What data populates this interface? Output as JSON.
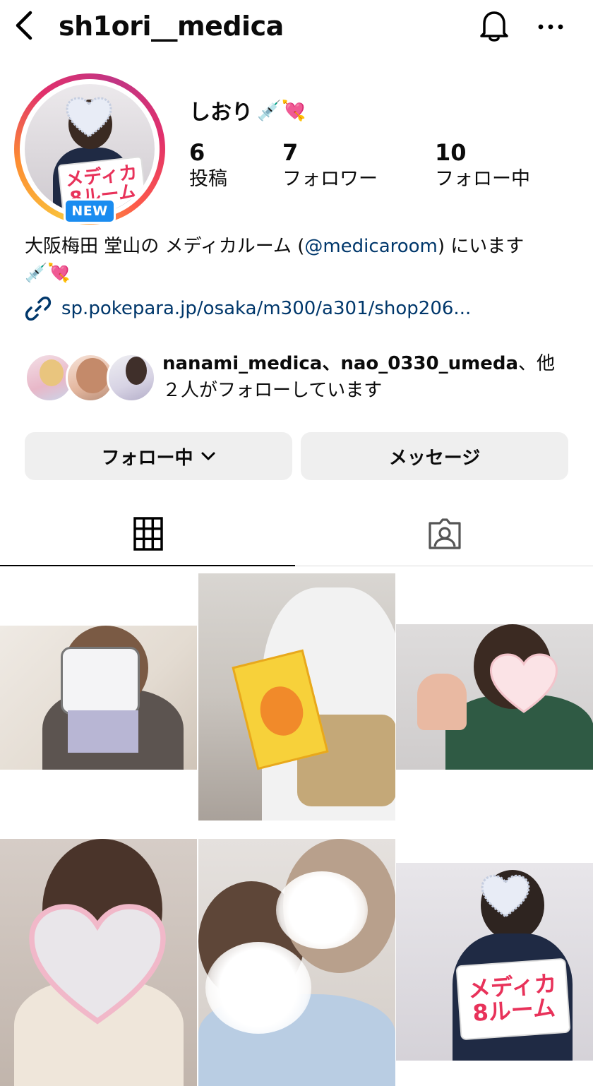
{
  "header": {
    "username": "sh1ori__medica"
  },
  "profile": {
    "new_badge": "NEW",
    "display_name": "しおり",
    "display_name_emoji": "💉💘",
    "stats": [
      {
        "value": "6",
        "label": "投稿"
      },
      {
        "value": "7",
        "label": "フォロワー"
      },
      {
        "value": "10",
        "label": "フォロー中"
      }
    ],
    "bio_prefix": "大阪梅田 堂山の メディカルーム (",
    "bio_mention": "@medicaroom",
    "bio_suffix": ") にいます",
    "bio_emoji": "💉💘",
    "link": "sp.pokepara.jp/osaka/m300/a301/shop206..."
  },
  "mutuals": {
    "names": "nanami_medica、nao_0330_umeda",
    "separator": "、他",
    "rest": "２人がフォローしています"
  },
  "actions": {
    "following_label": "フォロー中",
    "message_label": "メッセージ"
  },
  "sign_text": {
    "line1": "メディカ",
    "line2": "8ルーム"
  },
  "colors": {
    "link": "#00376b",
    "badge": "#1a8cf0",
    "button_bg": "#efefef",
    "divider": "#dbdbdb"
  },
  "icons": [
    "back-icon",
    "bell-icon",
    "more-icon",
    "link-icon",
    "chevron-down-icon",
    "grid-icon",
    "tagged-icon"
  ]
}
